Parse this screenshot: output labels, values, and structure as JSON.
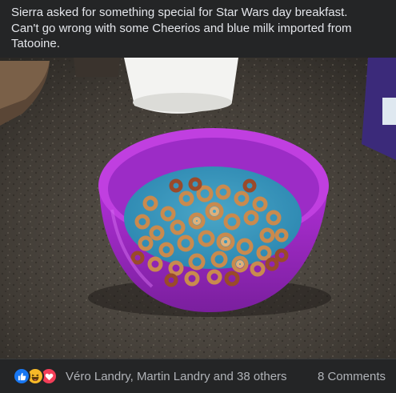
{
  "post": {
    "caption": "Sierra asked for something special for Star Wars day breakfast.\nCan't go wrong with some Cheerios and blue milk imported from\nTatooine."
  },
  "footer": {
    "reactions": [
      "like-icon",
      "haha-icon",
      "love-icon"
    ],
    "names": "Véro Landry, Martin Landry and 38 others",
    "comments": "8 Comments"
  },
  "colors": {
    "background": "#242526",
    "text": "#e4e6eb",
    "secondary_text": "#b0b3b8",
    "like": "#1877f2",
    "haha": "#f7b928",
    "love": "#f33e58"
  }
}
